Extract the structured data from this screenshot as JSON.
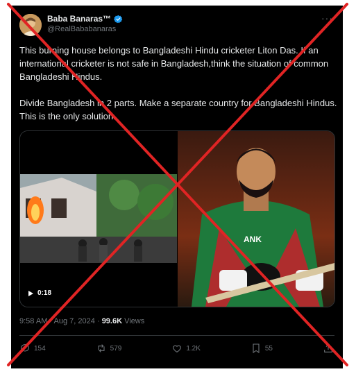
{
  "author": {
    "display_name": "Baba Banaras™",
    "handle": "@RealBababanaras"
  },
  "tweet": {
    "text_paragraph_1": "This burning house belongs to Bangladeshi Hindu cricketer Liton Das. If an international cricketer is not safe in Bangladesh,think the situation of common Bangladeshi Hindus.",
    "text_paragraph_2": "Divide Bangladesh in 2 parts. Make a separate country for Bangladeshi Hindus. This is the only solution.",
    "video_duration": "0:18",
    "time": "9:58 AM",
    "separator": "·",
    "date": "Aug 7, 2024",
    "views_count": "99.6K",
    "views_label": "Views"
  },
  "actions": {
    "replies": "154",
    "reposts": "579",
    "likes": "1.2K",
    "bookmarks": "55"
  },
  "icons": [
    "verified-badge-icon",
    "more-icon",
    "play-icon",
    "reply-icon",
    "repost-icon",
    "like-icon",
    "bookmark-icon",
    "share-icon"
  ],
  "colors": {
    "background": "#000000",
    "text": "#e7e9ea",
    "muted": "#71767b",
    "verified": "#1d9bf0",
    "overlay_cross": "#e02424"
  }
}
